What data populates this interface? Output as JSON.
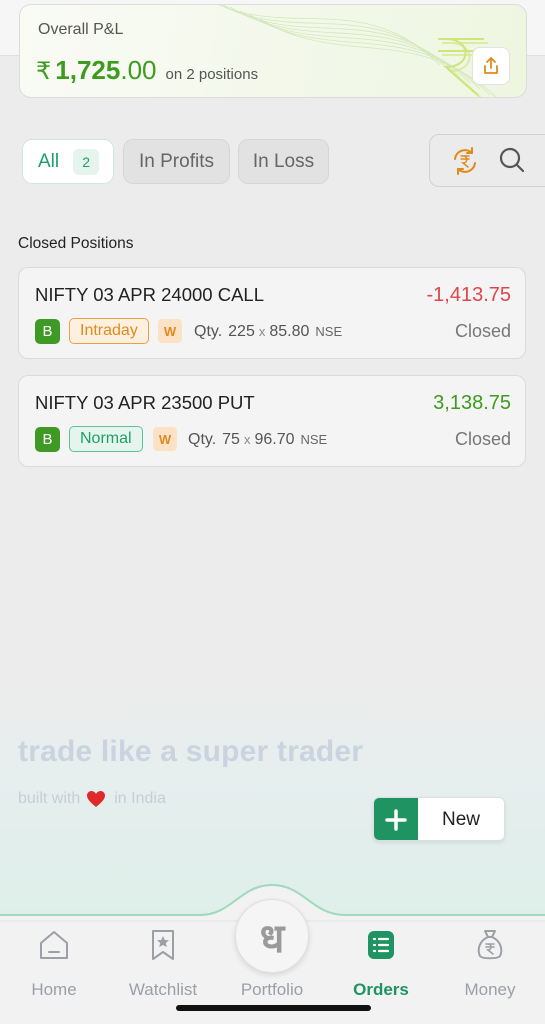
{
  "pnl": {
    "label": "Overall P&L",
    "currency": "₹",
    "value_int": "1,725",
    "value_dec": ".00",
    "subtext": "on 2 positions"
  },
  "filters": {
    "all_label": "All",
    "all_count": "2",
    "profits_label": "In Profits",
    "loss_label": "In Loss"
  },
  "section_title": "Closed Positions",
  "positions": [
    {
      "name": "NIFTY 03 APR 24000 CALL",
      "pnl": "-1,413.75",
      "pnl_color": "#e0454c",
      "side": "B",
      "product": "Intraday",
      "product_color": "#e08a1e",
      "product_bg": "#fdf0df",
      "flag": "W",
      "qty_label": "Qty.",
      "qty": "225",
      "x": "x",
      "price": "85.80",
      "exchange": "NSE",
      "status": "Closed"
    },
    {
      "name": "NIFTY 03 APR 23500 PUT",
      "pnl": "3,138.75",
      "pnl_color": "#3d9c1e",
      "side": "B",
      "product": "Normal",
      "product_color": "#1f9e68",
      "product_bg": "#e5f5ed",
      "flag": "W",
      "qty_label": "Qty.",
      "qty": "75",
      "x": "x",
      "price": "96.70",
      "exchange": "NSE",
      "status": "Closed"
    }
  ],
  "branding": {
    "tagline": "trade like a super trader",
    "built_prefix": "built with",
    "built_suffix": "in India"
  },
  "new_button": {
    "label": "New"
  },
  "nav": {
    "home": "Home",
    "watchlist": "Watchlist",
    "portfolio": "Portfolio",
    "orders": "Orders",
    "money": "Money",
    "center_glyph": "ध"
  },
  "colors": {
    "accent": "#1f9462",
    "profit": "#3d9c1e",
    "loss": "#e0454c"
  },
  "icons": [
    "share-icon",
    "refresh-rupee-icon",
    "search-icon",
    "plus-icon",
    "home-icon",
    "bookmark-star-icon",
    "orders-list-icon",
    "money-bag-icon",
    "heart-icon",
    "rupee-watermark-icon"
  ]
}
